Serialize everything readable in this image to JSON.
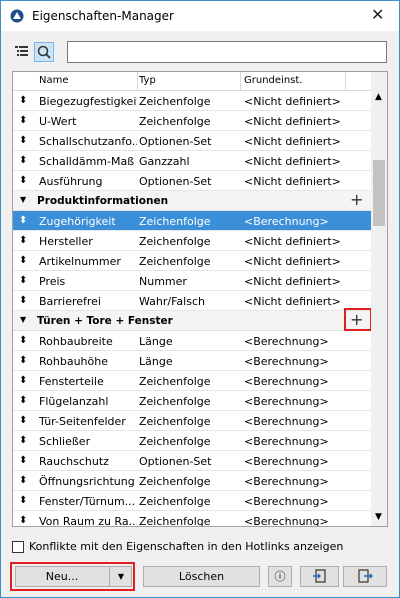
{
  "window": {
    "title": "Eigenschaften-Manager",
    "close_glyph": "✕"
  },
  "columns": {
    "name": "Name",
    "type": "Typ",
    "default": "Grundeinst."
  },
  "rows_top": [
    {
      "name": "Biegezugfestigkeit",
      "type": "Zeichenfolge",
      "default": "<Nicht definiert>"
    },
    {
      "name": "U-Wert",
      "type": "Zeichenfolge",
      "default": "<Nicht definiert>"
    },
    {
      "name": "Schallschutzanfo...",
      "type": "Optionen-Set",
      "default": "<Nicht definiert>"
    },
    {
      "name": "Schalldämm-Maß",
      "type": "Ganzzahl",
      "default": "<Nicht definiert>"
    },
    {
      "name": "Ausführung",
      "type": "Optionen-Set",
      "default": "<Nicht definiert>"
    }
  ],
  "group1": {
    "label": "Produktinformationen"
  },
  "rows_g1": [
    {
      "name": "Zugehörigkeit",
      "type": "Zeichenfolge",
      "default": "<Berechnung>"
    },
    {
      "name": "Hersteller",
      "type": "Zeichenfolge",
      "default": "<Nicht definiert>"
    },
    {
      "name": "Artikelnummer",
      "type": "Zeichenfolge",
      "default": "<Nicht definiert>"
    },
    {
      "name": "Preis",
      "type": "Nummer",
      "default": "<Nicht definiert>"
    },
    {
      "name": "Barrierefrei",
      "type": "Wahr/Falsch",
      "default": "<Nicht definiert>"
    }
  ],
  "group2": {
    "label": "Türen + Tore + Fenster"
  },
  "rows_g2": [
    {
      "name": "Rohbaubreite",
      "type": "Länge",
      "default": "<Berechnung>"
    },
    {
      "name": "Rohbauhöhe",
      "type": "Länge",
      "default": "<Berechnung>"
    },
    {
      "name": "Fensterteile",
      "type": "Zeichenfolge",
      "default": "<Berechnung>"
    },
    {
      "name": "Flügelanzahl",
      "type": "Zeichenfolge",
      "default": "<Berechnung>"
    },
    {
      "name": "Tür-Seitenfelder",
      "type": "Zeichenfolge",
      "default": "<Berechnung>"
    },
    {
      "name": "Schließer",
      "type": "Zeichenfolge",
      "default": "<Berechnung>"
    },
    {
      "name": "Rauchschutz",
      "type": "Optionen-Set",
      "default": "<Berechnung>"
    },
    {
      "name": "Öffnungsrichtung",
      "type": "Zeichenfolge",
      "default": "<Berechnung>"
    },
    {
      "name": "Fenster/Türnum...",
      "type": "Zeichenfolge",
      "default": "<Berechnung>"
    },
    {
      "name": "Von Raum zu Ra...",
      "type": "Zeichenfolge",
      "default": "<Berechnung>"
    }
  ],
  "glyphs": {
    "updown": "⬍",
    "plus": "+",
    "triangle": "▼",
    "scroll_up": "▲",
    "scroll_down": "▼",
    "dropdown": "▼",
    "info": "ⓘ"
  },
  "checkbox_label": "Konflikte mit den Eigenschaften in den Hotlinks anzeigen",
  "buttons": {
    "new": "Neu...",
    "delete": "Löschen"
  },
  "colors": {
    "selection": "#3b8fd8",
    "highlight_box": "#e0201f",
    "window_border": "#3c8fc9"
  }
}
